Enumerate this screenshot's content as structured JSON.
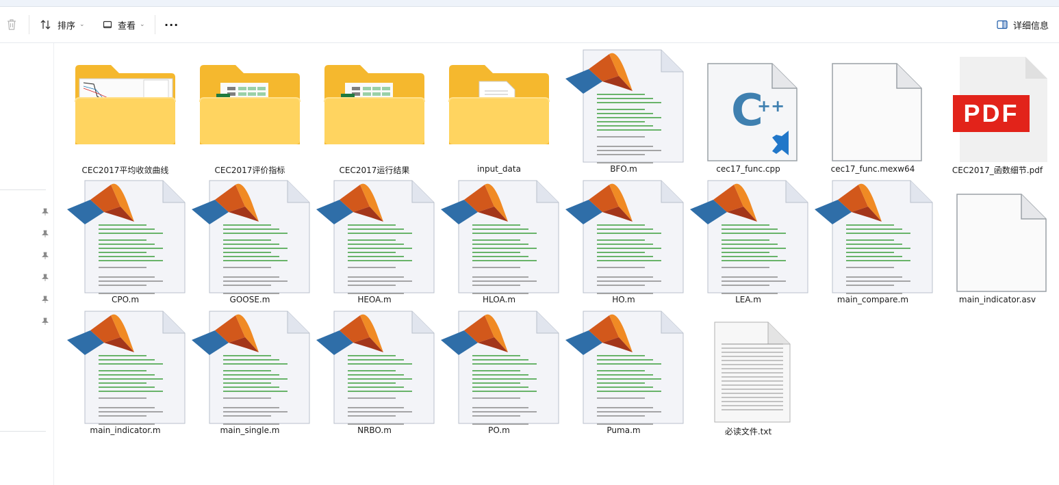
{
  "toolbar": {
    "sort_label": "排序",
    "view_label": "查看",
    "more_label": "···",
    "details_label": "详细信息"
  },
  "files": [
    {
      "name": "CEC2017平均收敛曲线",
      "kind": "folder-chart"
    },
    {
      "name": "CEC2017评价指标",
      "kind": "folder-excel"
    },
    {
      "name": "CEC2017运行结果",
      "kind": "folder-excel"
    },
    {
      "name": "input_data",
      "kind": "folder-doc"
    },
    {
      "name": "BFO.m",
      "kind": "matlab"
    },
    {
      "name": "cec17_func.cpp",
      "kind": "cpp"
    },
    {
      "name": "cec17_func.mexw64",
      "kind": "blank"
    },
    {
      "name": "CEC2017_函数细节.pdf",
      "kind": "pdf"
    },
    {
      "name": "CPO.m",
      "kind": "matlab"
    },
    {
      "name": "GOOSE.m",
      "kind": "matlab"
    },
    {
      "name": "HEOA.m",
      "kind": "matlab"
    },
    {
      "name": "HLOA.m",
      "kind": "matlab"
    },
    {
      "name": "HO.m",
      "kind": "matlab"
    },
    {
      "name": "LEA.m",
      "kind": "matlab"
    },
    {
      "name": "main_compare.m",
      "kind": "matlab"
    },
    {
      "name": "main_indicator.asv",
      "kind": "blank"
    },
    {
      "name": "main_indicator.m",
      "kind": "matlab"
    },
    {
      "name": "main_single.m",
      "kind": "matlab"
    },
    {
      "name": "NRBO.m",
      "kind": "matlab"
    },
    {
      "name": "PO.m",
      "kind": "matlab"
    },
    {
      "name": "Puma.m",
      "kind": "matlab"
    },
    {
      "name": "必读文件.txt",
      "kind": "txt"
    }
  ],
  "icons": {
    "pdf_text": "PDF",
    "cpp_text": "C++"
  },
  "colors": {
    "folder_back": "#f5b82e",
    "folder_front": "#ffd460",
    "excel_green": "#1e7a3f",
    "pdf_red": "#e2231a",
    "cpp_blue": "#3f80b0",
    "vscode_blue": "#2177c9"
  }
}
